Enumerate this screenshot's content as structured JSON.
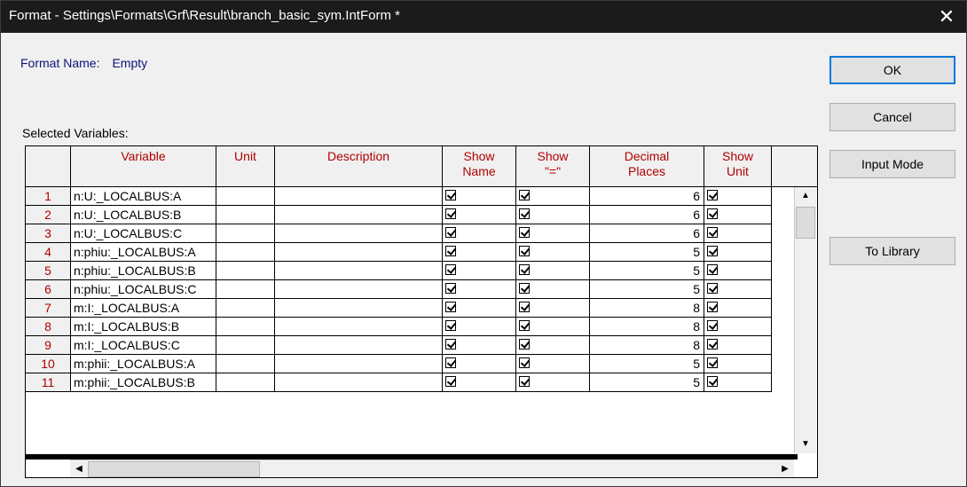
{
  "window": {
    "title": "Format - Settings\\Formats\\Grf\\Result\\branch_basic_sym.IntForm *",
    "close_glyph": "✕"
  },
  "format": {
    "label": "Format Name:",
    "value": "Empty"
  },
  "selected_variables_label": "Selected Variables:",
  "buttons": {
    "ok": "OK",
    "cancel": "Cancel",
    "input_mode": "Input Mode",
    "to_library": "To Library"
  },
  "table": {
    "headers": {
      "variable": "Variable",
      "unit": "Unit",
      "description": "Description",
      "show_name_1": "Show",
      "show_name_2": "Name",
      "show_eq_1": "Show",
      "show_eq_2": "\"=\"",
      "decimal_1": "Decimal",
      "decimal_2": "Places",
      "show_unit_1": "Show",
      "show_unit_2": "Unit"
    },
    "rows": [
      {
        "num": "1",
        "variable": "n:U:_LOCALBUS:A",
        "unit": "",
        "description": "",
        "decimal": "6"
      },
      {
        "num": "2",
        "variable": "n:U:_LOCALBUS:B",
        "unit": "",
        "description": "",
        "decimal": "6"
      },
      {
        "num": "3",
        "variable": "n:U:_LOCALBUS:C",
        "unit": "",
        "description": "",
        "decimal": "6"
      },
      {
        "num": "4",
        "variable": "n:phiu:_LOCALBUS:A",
        "unit": "",
        "description": "",
        "decimal": "5"
      },
      {
        "num": "5",
        "variable": "n:phiu:_LOCALBUS:B",
        "unit": "",
        "description": "",
        "decimal": "5"
      },
      {
        "num": "6",
        "variable": "n:phiu:_LOCALBUS:C",
        "unit": "",
        "description": "",
        "decimal": "5"
      },
      {
        "num": "7",
        "variable": "m:I:_LOCALBUS:A",
        "unit": "",
        "description": "",
        "decimal": "8"
      },
      {
        "num": "8",
        "variable": "m:I:_LOCALBUS:B",
        "unit": "",
        "description": "",
        "decimal": "8"
      },
      {
        "num": "9",
        "variable": "m:I:_LOCALBUS:C",
        "unit": "",
        "description": "",
        "decimal": "8"
      },
      {
        "num": "10",
        "variable": "m:phii:_LOCALBUS:A",
        "unit": "",
        "description": "",
        "decimal": "5"
      },
      {
        "num": "11",
        "variable": "m:phii:_LOCALBUS:B",
        "unit": "",
        "description": "",
        "decimal": "5"
      }
    ]
  },
  "scroll": {
    "up": "▲",
    "down": "▼",
    "left": "◀",
    "right": "▶"
  }
}
